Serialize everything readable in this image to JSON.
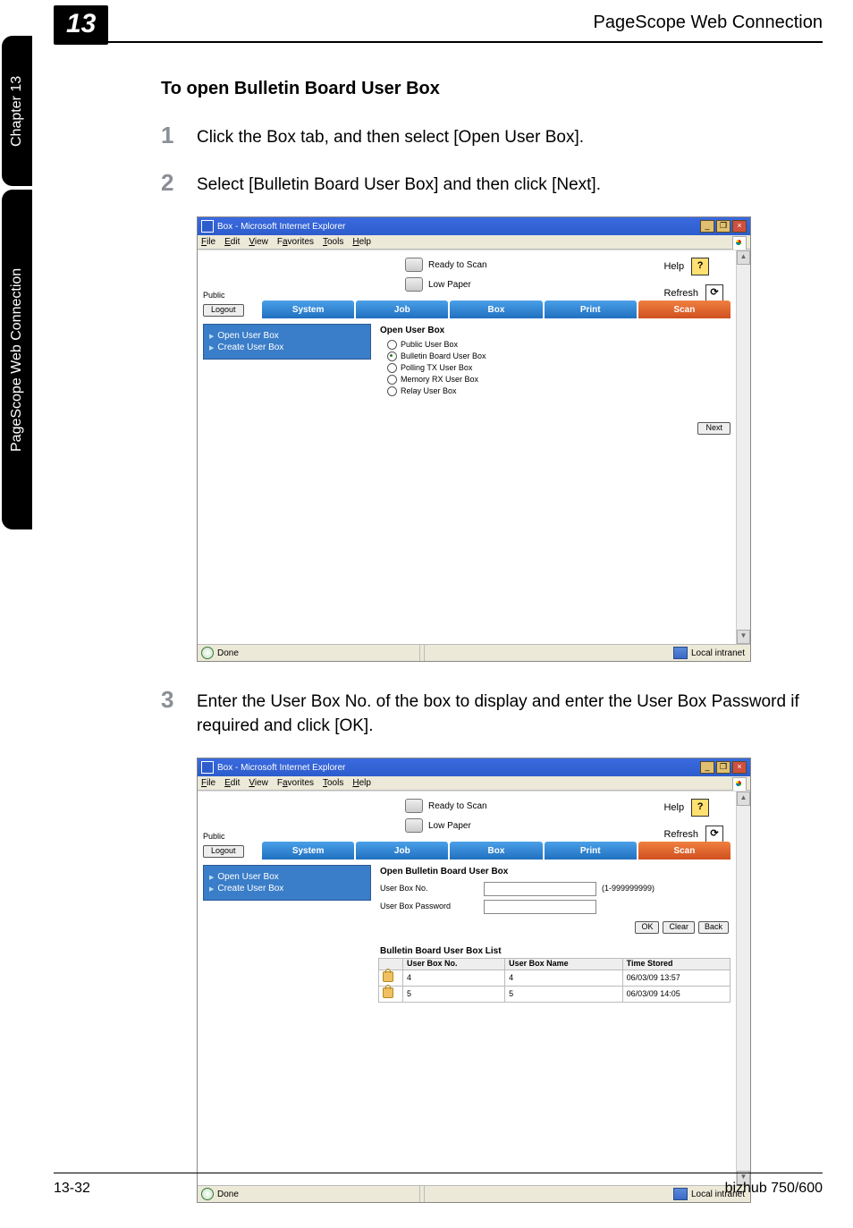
{
  "side_tab_chapter": "Chapter 13",
  "side_tab_product": "PageScope Web Connection",
  "chapter_badge": "13",
  "header_title": "PageScope Web Connection",
  "section_heading": "To open Bulletin Board User Box",
  "steps": {
    "s1_num": "1",
    "s1_text": "Click the Box tab, and then select [Open User Box].",
    "s2_num": "2",
    "s2_text": "Select [Bulletin Board User Box] and then click [Next].",
    "s3_num": "3",
    "s3_text": "Enter the User Box No. of the box to display and enter the User Box Password if required and click [OK]."
  },
  "browser": {
    "title": "Box - Microsoft Internet Explorer",
    "menus": {
      "file": "File",
      "edit": "Edit",
      "view": "View",
      "favorites": "Favorites",
      "tools": "Tools",
      "help": "Help"
    },
    "status": {
      "ready": "Ready to Scan",
      "lowpaper": "Low Paper"
    },
    "links": {
      "help": "Help",
      "refresh": "Refresh"
    },
    "public": "Public",
    "logout": "Logout",
    "tabs": {
      "system": "System",
      "job": "Job",
      "box": "Box",
      "print": "Print",
      "scan": "Scan"
    },
    "left": {
      "open": "Open User Box",
      "create": "Create User Box"
    },
    "next_btn": "Next",
    "status_bar": {
      "done": "Done",
      "intranet": "Local intranet"
    }
  },
  "shot1": {
    "panel_title": "Open User Box",
    "opts": {
      "public": "Public User Box",
      "bulletin": "Bulletin Board User Box",
      "polling": "Polling TX User Box",
      "memory": "Memory RX User Box",
      "relay": "Relay User Box"
    }
  },
  "shot2": {
    "panel_title": "Open Bulletin Board User Box",
    "userboxno_label": "User Box No.",
    "userboxpw_label": "User Box Password",
    "hint_range": "(1-999999999)",
    "buttons": {
      "ok": "OK",
      "clear": "Clear",
      "back": "Back"
    },
    "list_heading": "Bulletin Board User Box List",
    "columns": {
      "no": "User Box No.",
      "name": "User Box Name",
      "time": "Time Stored"
    },
    "rows": [
      {
        "no": "4",
        "name": "4",
        "time": "06/03/09 13:57"
      },
      {
        "no": "5",
        "name": "5",
        "time": "06/03/09 14:05"
      }
    ]
  },
  "footer": {
    "left": "13-32",
    "right": "bizhub 750/600"
  }
}
